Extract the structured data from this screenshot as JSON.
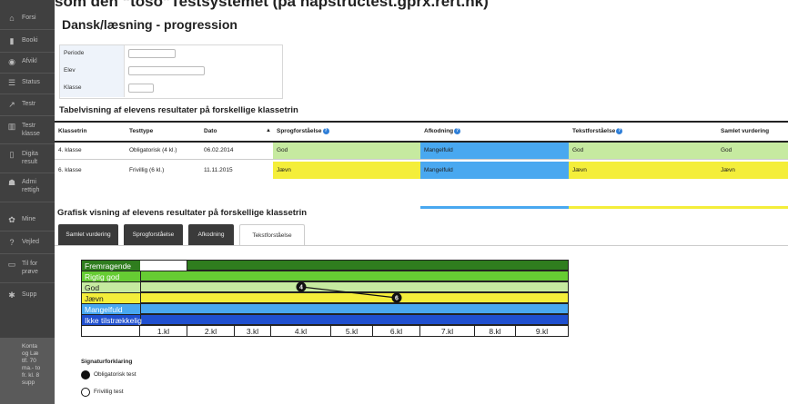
{
  "caption": "som den “toso”Testsystemet (på hapstructest.gprx.rert.hk)",
  "sidebar": {
    "items": [
      {
        "label": "Forsi",
        "icon": "home-icon"
      },
      {
        "label": "Booki",
        "icon": "book-icon"
      },
      {
        "label": "Afvikl",
        "icon": "eye-icon"
      },
      {
        "label": "Status",
        "icon": "list-icon"
      },
      {
        "label": "Testr",
        "icon": "trend-icon"
      },
      {
        "label": "Testr",
        "label2": "klasse",
        "icon": "bar-chart-icon"
      },
      {
        "label": "Digita",
        "label2": "result",
        "icon": "document-icon"
      },
      {
        "label": "Admi",
        "label2": "rettigh",
        "icon": "users-icon"
      },
      {
        "label": "Mine",
        "icon": "gear-icon"
      },
      {
        "label": "Vejled",
        "icon": "question-icon"
      },
      {
        "label": "Til for",
        "label2": "prøve",
        "icon": "monitor-icon"
      },
      {
        "label": "Supp",
        "icon": "settings-icon"
      }
    ],
    "contact": [
      "Konta",
      "og Læ",
      "tlf. 70",
      "ma.- to",
      "fr. kl. 8",
      "supp"
    ]
  },
  "page": {
    "title": "Dansk/læsning - progression",
    "filters": [
      {
        "label": "Periode",
        "value": ""
      },
      {
        "label": "Elev",
        "value": ""
      },
      {
        "label": "Klasse",
        "value": ""
      }
    ],
    "table_heading": "Tabelvisning af elevens resultater på forskellige klassetrin",
    "chart_heading": "Grafisk visning af elevens resultater på forskellige klassetrin"
  },
  "table": {
    "headers": [
      "Klassetrin",
      "Testtype",
      "Dato",
      "Sprogforståelse",
      "Afkodning",
      "Tekstforståelse",
      "Samlet vurdering"
    ],
    "rows": [
      [
        "4. klasse",
        "Obligatorisk (4 kl.)",
        "06.02.2014",
        "God",
        "Mangelfuld",
        "God",
        "God"
      ],
      [
        "6. klasse",
        "Frivillig (6 kl.)",
        "11.11.2015",
        "Jævn",
        "Mangelfuld",
        "Jævn",
        "Jævn"
      ]
    ]
  },
  "tabs": [
    "Samlet vurdering",
    "Sprogforståelse",
    "Afkodning",
    "Tekstforståelse"
  ],
  "colors": {
    "Fremragende": "#2f7d1e",
    "Rigtig god": "#66cc33",
    "God": "#c6eaa0",
    "Jævn": "#f4ee3a",
    "Mangelfuld": "#49a8f0",
    "Ikke tilstrækkelig": "#1f4fcf"
  },
  "chart_data": {
    "type": "line",
    "levels": [
      "Fremragende",
      "Rigtig god",
      "God",
      "Jævn",
      "Mangelfuld",
      "Ikke tilstrækkelig"
    ],
    "categories": [
      "1.kl",
      "2.kl",
      "3.kl",
      "4.kl",
      "5.kl",
      "6.kl",
      "7.kl",
      "8.kl",
      "9.kl"
    ],
    "points": [
      {
        "x": "4.kl",
        "y": "God",
        "label": "4",
        "test": "Obligatorisk test"
      },
      {
        "x": "6.kl",
        "y": "Jævn",
        "label": "6",
        "test": "Obligatorisk test"
      }
    ]
  },
  "legend": {
    "heading": "Signaturforklaring",
    "items": [
      "Obligatorisk test",
      "Frivillig test"
    ]
  }
}
